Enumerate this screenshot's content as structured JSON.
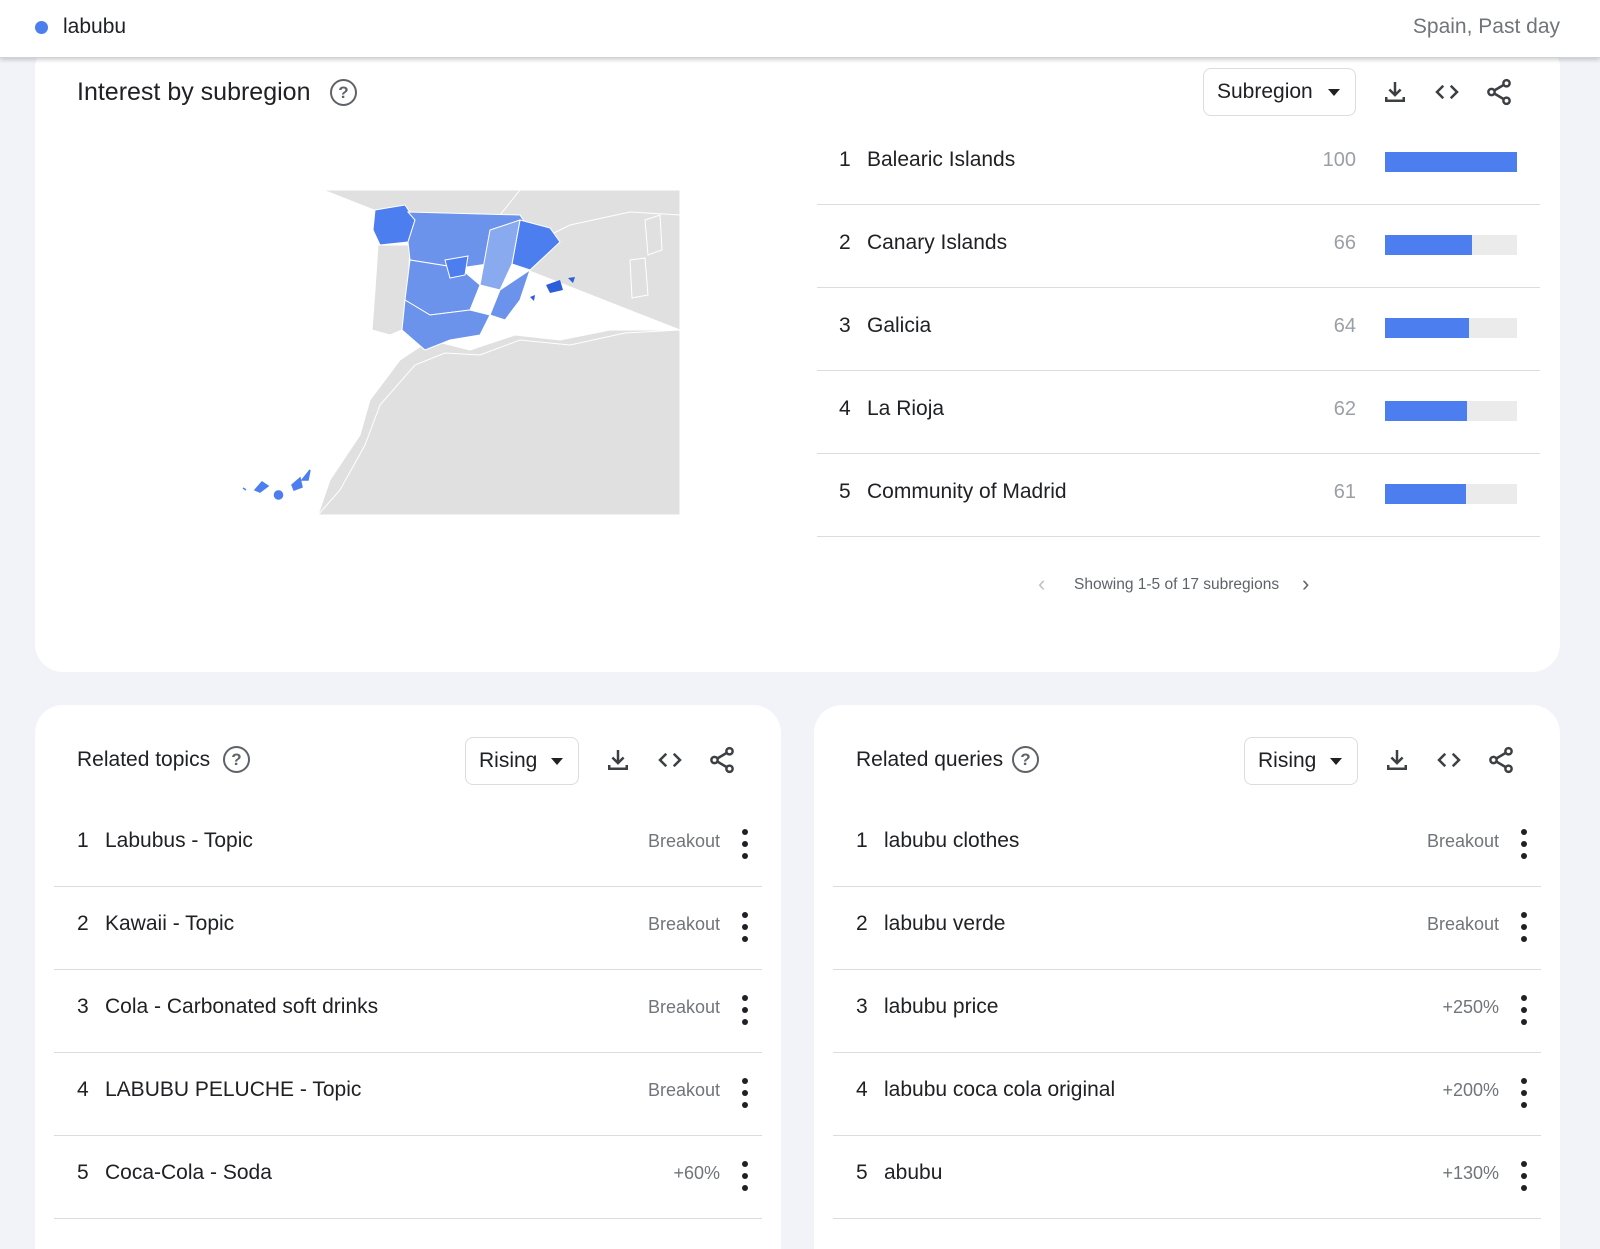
{
  "term_bar": {
    "term": "labubu",
    "term_color": "#4c7ef0",
    "filter": "Spain, Past day"
  },
  "subregion_card": {
    "title": "Interest by subregion",
    "help_icon": "help-circle-icon",
    "dropdown_value": "Subregion",
    "tools": [
      "download-icon",
      "embed-code-icon",
      "share-icon"
    ],
    "rows": [
      {
        "rank": "1",
        "name": "Balearic Islands",
        "value": "100",
        "fraction": 1.0
      },
      {
        "rank": "2",
        "name": "Canary Islands",
        "value": "66",
        "fraction": 0.66
      },
      {
        "rank": "3",
        "name": "Galicia",
        "value": "64",
        "fraction": 0.64
      },
      {
        "rank": "4",
        "name": "La Rioja",
        "value": "62",
        "fraction": 0.62
      },
      {
        "rank": "5",
        "name": "Community of Madrid",
        "value": "61",
        "fraction": 0.61
      }
    ],
    "pager_text": "Showing 1-5 of 17 subregions",
    "bar_color": "#4c7ef0"
  },
  "related_topics": {
    "title": "Related topics",
    "dropdown_value": "Rising",
    "rows": [
      {
        "rank": "1",
        "name": "Labubus - Topic",
        "value": "Breakout"
      },
      {
        "rank": "2",
        "name": "Kawaii - Topic",
        "value": "Breakout"
      },
      {
        "rank": "3",
        "name": "Cola - Carbonated soft drinks",
        "value": "Breakout"
      },
      {
        "rank": "4",
        "name": "LABUBU PELUCHE - Topic",
        "value": "Breakout"
      },
      {
        "rank": "5",
        "name": "Coca-Cola - Soda",
        "value": "+60%"
      }
    ]
  },
  "related_queries": {
    "title": "Related queries",
    "dropdown_value": "Rising",
    "rows": [
      {
        "rank": "1",
        "name": "labubu clothes",
        "value": "Breakout"
      },
      {
        "rank": "2",
        "name": "labubu verde",
        "value": "Breakout"
      },
      {
        "rank": "3",
        "name": "labubu price",
        "value": "+250%"
      },
      {
        "rank": "4",
        "name": "labubu coca cola original",
        "value": "+200%"
      },
      {
        "rank": "5",
        "name": "abubu",
        "value": "+130%"
      }
    ]
  }
}
